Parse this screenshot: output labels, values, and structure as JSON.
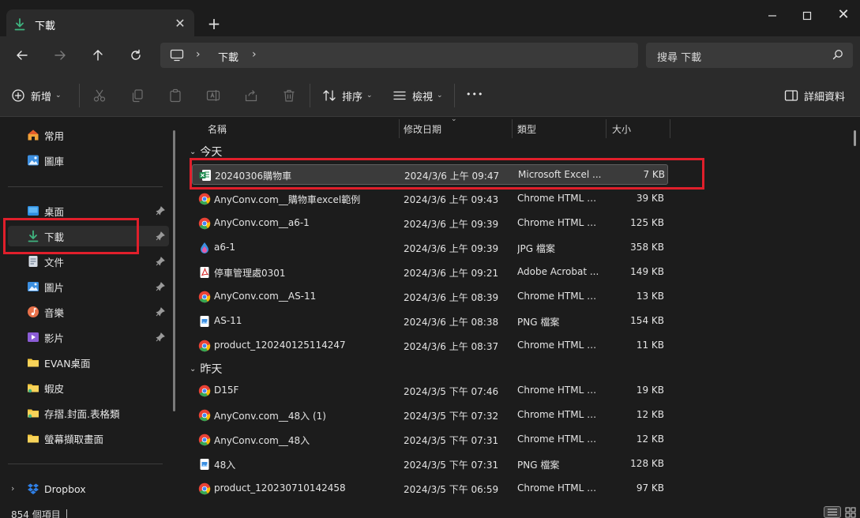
{
  "window": {
    "tab_label": "下載",
    "close_tab_glyph": "✕",
    "new_tab_glyph": "+",
    "close_window_glyph": "✕"
  },
  "nav": {
    "address_chevron": "›",
    "address_segment": "下載",
    "search_placeholder": "搜尋 下載"
  },
  "commands": {
    "new_label": "新增",
    "sort_label": "排序",
    "view_label": "檢視",
    "more_glyph": "•••",
    "details_label": "詳細資料",
    "caret_glyph": "⌄"
  },
  "sidebar": {
    "home": "常用",
    "gallery": "圖庫",
    "pinned": [
      {
        "label": "桌面"
      },
      {
        "label": "下載"
      },
      {
        "label": "文件"
      },
      {
        "label": "圖片"
      },
      {
        "label": "音樂"
      },
      {
        "label": "影片"
      }
    ],
    "folders": [
      {
        "label": "EVAN桌面"
      },
      {
        "label": "蝦皮"
      },
      {
        "label": "存摺.封面.表格類"
      },
      {
        "label": "螢幕擷取畫面"
      }
    ],
    "dropbox": "Dropbox",
    "expand_glyph": "›"
  },
  "columns": {
    "name": "名稱",
    "modified": "修改日期",
    "type": "類型",
    "size": "大小"
  },
  "groups": {
    "today": "今天",
    "yesterday": "昨天",
    "chevron": "⌄"
  },
  "files_today": [
    {
      "name": "20240306購物車",
      "date": "2024/3/6 上午 09:47",
      "type": "Microsoft Excel ...",
      "size": "7 KB",
      "icon": "excel-icon"
    },
    {
      "name": "AnyConv.com__購物車excel範例",
      "date": "2024/3/6 上午 09:43",
      "type": "Chrome HTML D...",
      "size": "39 KB",
      "icon": "chrome-icon"
    },
    {
      "name": "AnyConv.com__a6-1",
      "date": "2024/3/6 上午 09:39",
      "type": "Chrome HTML D...",
      "size": "125 KB",
      "icon": "chrome-icon"
    },
    {
      "name": "a6-1",
      "date": "2024/3/6 上午 09:39",
      "type": "JPG 檔案",
      "size": "358 KB",
      "icon": "photo-drop-icon"
    },
    {
      "name": "停車管理處0301",
      "date": "2024/3/6 上午 09:21",
      "type": "Adobe Acrobat ...",
      "size": "149 KB",
      "icon": "pdf-icon"
    },
    {
      "name": "AnyConv.com__AS-11",
      "date": "2024/3/6 上午 08:39",
      "type": "Chrome HTML D...",
      "size": "13 KB",
      "icon": "chrome-icon"
    },
    {
      "name": "AS-11",
      "date": "2024/3/6 上午 08:38",
      "type": "PNG 檔案",
      "size": "154 KB",
      "icon": "image-file-icon"
    },
    {
      "name": "product_120240125114247",
      "date": "2024/3/6 上午 08:37",
      "type": "Chrome HTML D...",
      "size": "11 KB",
      "icon": "chrome-icon"
    }
  ],
  "files_yesterday": [
    {
      "name": "D15F",
      "date": "2024/3/5 下午 07:46",
      "type": "Chrome HTML D...",
      "size": "19 KB",
      "icon": "chrome-icon"
    },
    {
      "name": "AnyConv.com__48入 (1)",
      "date": "2024/3/5 下午 07:32",
      "type": "Chrome HTML D...",
      "size": "12 KB",
      "icon": "chrome-icon"
    },
    {
      "name": "AnyConv.com__48入",
      "date": "2024/3/5 下午 07:31",
      "type": "Chrome HTML D...",
      "size": "12 KB",
      "icon": "chrome-icon"
    },
    {
      "name": "48入",
      "date": "2024/3/5 下午 07:31",
      "type": "PNG 檔案",
      "size": "128 KB",
      "icon": "image-file-icon"
    },
    {
      "name": "product_120230710142458",
      "date": "2024/3/5 下午 06:59",
      "type": "Chrome HTML D...",
      "size": "97 KB",
      "icon": "chrome-icon"
    }
  ],
  "status": {
    "item_count": "854 個項目"
  },
  "colors": {
    "highlight_red": "#e01f2b",
    "download_green": "#3fb37f",
    "folder_yellow": "#f2c53d"
  }
}
